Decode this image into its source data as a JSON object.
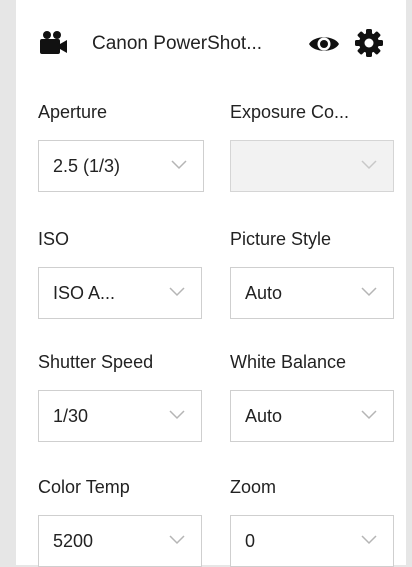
{
  "header": {
    "camera_icon": "video-camera-icon",
    "title": "Canon PowerShot...",
    "eye_icon": "eye-icon",
    "gear_icon": "gear-icon"
  },
  "fields": {
    "aperture": {
      "label": "Aperture",
      "value": "2.5 (1/3)"
    },
    "exposure_comp": {
      "label": "Exposure Co...",
      "value": ""
    },
    "iso": {
      "label": "ISO",
      "value": "ISO A..."
    },
    "picture_style": {
      "label": "Picture Style",
      "value": "Auto"
    },
    "shutter_speed": {
      "label": "Shutter Speed",
      "value": "1/30"
    },
    "white_balance": {
      "label": "White Balance",
      "value": "Auto"
    },
    "color_temp": {
      "label": "Color Temp",
      "value": "5200"
    },
    "zoom": {
      "label": "Zoom",
      "value": "0"
    }
  },
  "colors": {
    "background": "#e6e6e6",
    "panel": "#ffffff",
    "border": "#cfcfcf",
    "chevron": "#b5b5b5"
  }
}
